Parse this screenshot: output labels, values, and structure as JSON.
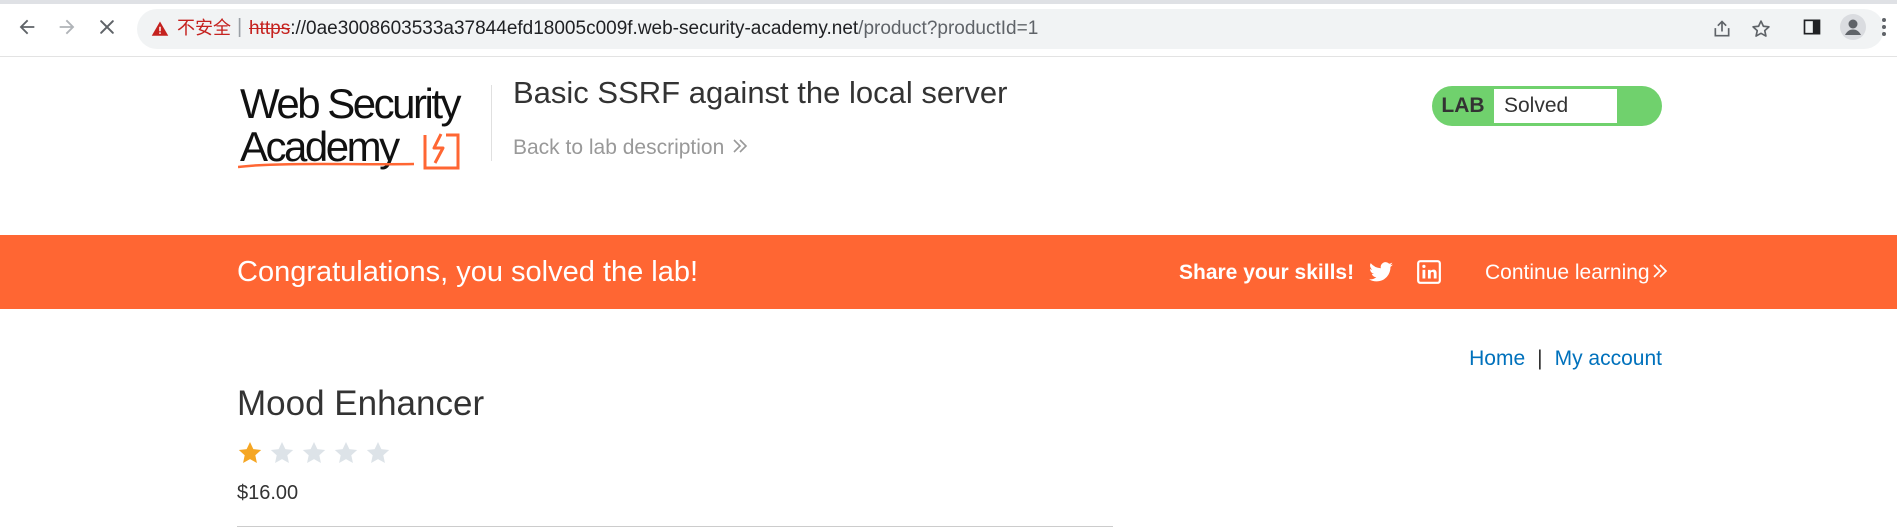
{
  "browser": {
    "security_label": "不安全",
    "separator": "|",
    "url_scheme": "https",
    "url_rest": "://",
    "url_host": "0ae3008603533a37844efd18005c009f.web-security-academy.net",
    "url_path": "/product?productId=1",
    "icons": [
      "back-arrow-icon",
      "forward-arrow-icon",
      "stop-loading-icon",
      "warning-icon",
      "share-icon",
      "bookmark-star-icon",
      "side-panel-icon",
      "profile-icon",
      "more-menu-icon"
    ]
  },
  "header": {
    "logo_line1": "Web Security",
    "logo_line2": "Academy",
    "lab_title": "Basic SSRF against the local server",
    "back_link": "Back to lab description",
    "lab_tag": "LAB",
    "lab_state": "Solved"
  },
  "banner": {
    "message": "Congratulations, you solved the lab!",
    "share_label": "Share your skills!",
    "continue_label": "Continue learning",
    "background_color": "#ff6633"
  },
  "nav": {
    "home": "Home",
    "separator": "|",
    "my_account": "My account"
  },
  "product": {
    "name": "Mood Enhancer",
    "rating": 1,
    "rating_max": 5,
    "price": "$16.00"
  },
  "colors": {
    "accent": "#ff6633",
    "link": "#0071bc",
    "solved": "#70d16d",
    "star_filled": "#f5a623",
    "star_empty": "#dde3e8"
  }
}
